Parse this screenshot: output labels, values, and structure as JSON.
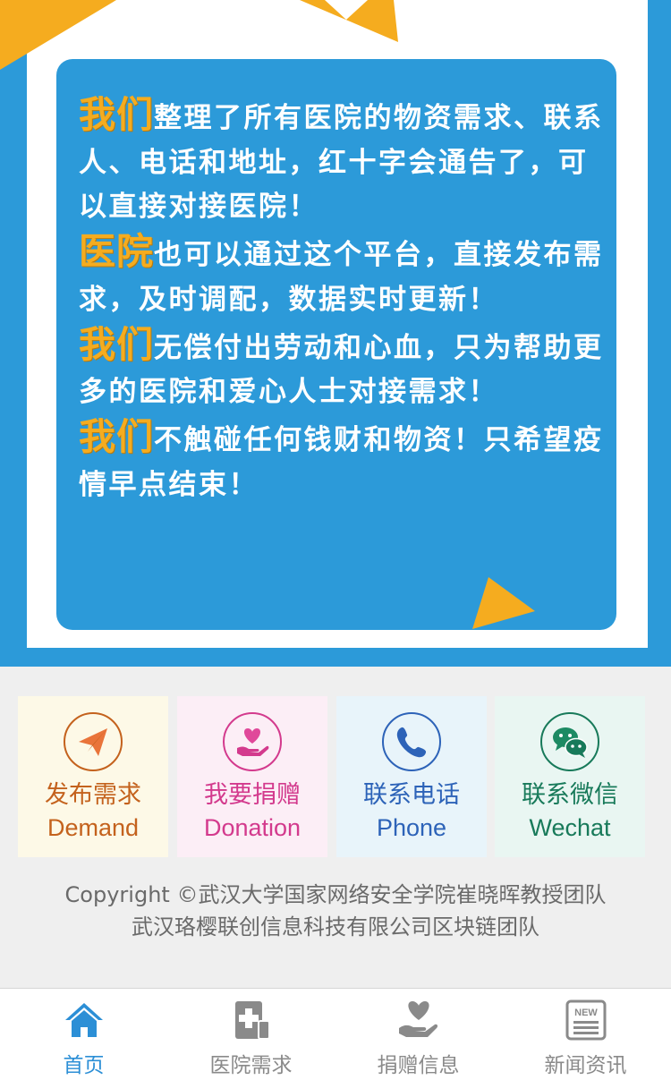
{
  "banner": {
    "paragraphs": [
      {
        "highlight": "我们",
        "text": "整理了所有医院的物资需求、联系人、电话和地址，红十字会通告了，可以直接对接医院！"
      },
      {
        "highlight": "医院",
        "text": "也可以通过这个平台，直接发布需求，及时调配，数据实时更新！"
      },
      {
        "highlight": "我们",
        "text": "无偿付出劳动和心血，只为帮助更多的医院和爱心人士对接需求！"
      },
      {
        "highlight": "我们",
        "text": "不触碰任何钱财和物资！只希望疫情早点结束！"
      }
    ],
    "colors": {
      "blue": "#2c9ad9",
      "orange": "#f5ac1f",
      "white": "#ffffff"
    }
  },
  "actions": [
    {
      "cn": "发布需求",
      "en": "Demand",
      "icon": "paper-plane-icon",
      "color": "#c4621d"
    },
    {
      "cn": "我要捐赠",
      "en": "Donation",
      "icon": "heart-hand-icon",
      "color": "#d33a8d"
    },
    {
      "cn": "联系电话",
      "en": "Phone",
      "icon": "phone-icon",
      "color": "#2d63b8"
    },
    {
      "cn": "联系微信",
      "en": "Wechat",
      "icon": "wechat-icon",
      "color": "#187a5a"
    }
  ],
  "copyright": {
    "line1": "Copyright ©武汉大学国家网络安全学院崔晓晖教授团队",
    "line2": "武汉珞樱联创信息科技有限公司区块链团队"
  },
  "nav": [
    {
      "label": "首页",
      "icon": "home-icon",
      "active": true
    },
    {
      "label": "医院需求",
      "icon": "hospital-icon",
      "active": false
    },
    {
      "label": "捐赠信息",
      "icon": "donation-icon",
      "active": false
    },
    {
      "label": "新闻资讯",
      "icon": "news-icon",
      "active": false
    }
  ],
  "nav_active_color": "#2c8fd6",
  "news_badge": "NEW"
}
